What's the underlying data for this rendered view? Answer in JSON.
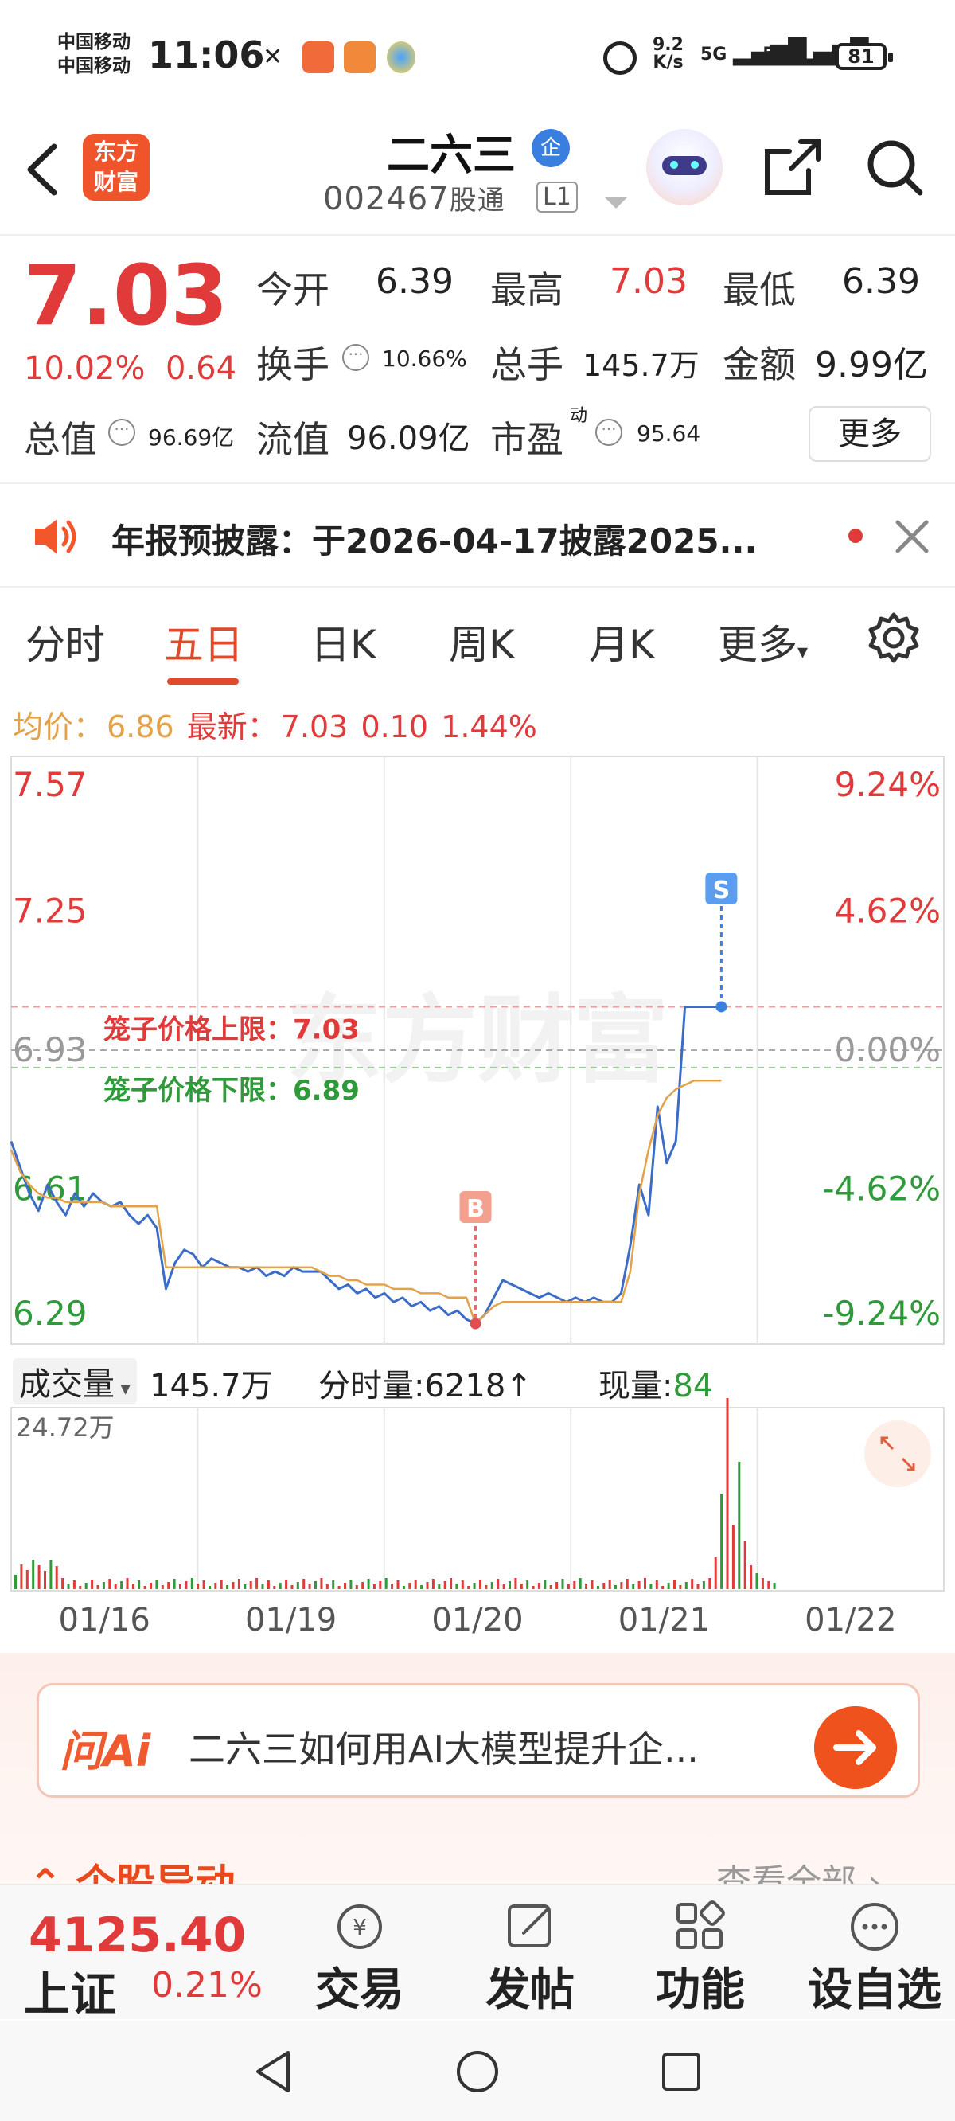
{
  "status_bar": {
    "carrier_1": "中国移动",
    "carrier_2": "中国移动",
    "time": "11:06",
    "net_speed_value": "9.2",
    "net_speed_unit": "K/s",
    "signal_1": "5G",
    "signal_2": "5G",
    "battery": "81"
  },
  "header": {
    "logo_line1": "东方",
    "logo_line2": "财富",
    "stock_name": "二六三",
    "badge": "企",
    "stock_code": "002467",
    "connect_label": "股通",
    "level": "L1"
  },
  "quote": {
    "price": "7.03",
    "change_pct": "10.02%",
    "change_abs": "0.64",
    "open_label": "今开",
    "open": "6.39",
    "high_label": "最高",
    "high": "7.03",
    "low_label": "最低",
    "low": "6.39",
    "turnover_label": "换手",
    "turnover": "10.66%",
    "volume_label": "总手",
    "volume": "145.7万",
    "amount_label": "金额",
    "amount": "9.99亿",
    "mktcap_label": "总值",
    "mktcap": "96.69亿",
    "float_label": "流值",
    "float_cap": "96.09亿",
    "pe_label": "市盈",
    "pe_sup": "动",
    "pe": "95.64",
    "more_label": "更多"
  },
  "notice": {
    "text": "年报预披露：于2026-04-17披露2025..."
  },
  "tabs": [
    {
      "label": "分时"
    },
    {
      "label": "五日"
    },
    {
      "label": "日K"
    },
    {
      "label": "周K"
    },
    {
      "label": "月K"
    },
    {
      "label": "更多"
    }
  ],
  "avg": {
    "avg_label": "均价：",
    "avg_value": "6.86",
    "latest_label": "最新：",
    "latest_value": "7.03",
    "latest_change": "0.10",
    "latest_pct": "1.44%"
  },
  "chart_data": {
    "type": "line",
    "y_labels_left": [
      "7.57",
      "7.25",
      "6.93",
      "6.61",
      "6.29"
    ],
    "y_labels_right": [
      "9.24%",
      "4.62%",
      "0.00%",
      "-4.62%",
      "-9.24%"
    ],
    "ylim": [
      6.29,
      7.57
    ],
    "x_labels": [
      "01/16",
      "01/19",
      "01/20",
      "01/21",
      "01/22"
    ],
    "cage_upper_label": "笼子价格上限：7.03",
    "cage_lower_label": "笼子价格下限：6.89",
    "cage_upper": 7.03,
    "cage_lower": 6.89,
    "buy_marker": "B",
    "sell_marker": "S",
    "watermark": "东方财富",
    "series": [
      {
        "name": "price",
        "color": "#3b6cc7",
        "values": [
          6.72,
          6.66,
          6.6,
          6.56,
          6.62,
          6.58,
          6.55,
          6.6,
          6.57,
          6.6,
          6.58,
          6.57,
          6.58,
          6.55,
          6.53,
          6.55,
          6.52,
          6.38,
          6.44,
          6.47,
          6.46,
          6.43,
          6.45,
          6.44,
          6.43,
          6.43,
          6.42,
          6.43,
          6.41,
          6.42,
          6.41,
          6.43,
          6.42,
          6.42,
          6.42,
          6.4,
          6.38,
          6.39,
          6.37,
          6.38,
          6.36,
          6.37,
          6.35,
          6.36,
          6.34,
          6.35,
          6.33,
          6.34,
          6.32,
          6.33,
          6.31,
          6.3,
          6.32,
          6.36,
          6.4,
          6.39,
          6.38,
          6.37,
          6.36,
          6.37,
          6.36,
          6.35,
          6.36,
          6.35,
          6.36,
          6.35,
          6.35,
          6.37,
          6.48,
          6.62,
          6.55,
          6.8,
          6.67,
          6.72,
          7.03,
          7.03,
          7.03,
          7.03,
          7.03
        ]
      },
      {
        "name": "avg",
        "color": "#e3a24a",
        "values": [
          6.7,
          6.65,
          6.62,
          6.6,
          6.59,
          6.59,
          6.58,
          6.58,
          6.58,
          6.58,
          6.58,
          6.57,
          6.57,
          6.57,
          6.57,
          6.57,
          6.57,
          6.43,
          6.43,
          6.43,
          6.43,
          6.43,
          6.43,
          6.43,
          6.43,
          6.43,
          6.43,
          6.43,
          6.43,
          6.43,
          6.43,
          6.43,
          6.43,
          6.43,
          6.42,
          6.41,
          6.41,
          6.4,
          6.4,
          6.39,
          6.39,
          6.39,
          6.38,
          6.38,
          6.38,
          6.37,
          6.37,
          6.37,
          6.36,
          6.36,
          6.36,
          6.3,
          6.32,
          6.34,
          6.35,
          6.35,
          6.35,
          6.35,
          6.35,
          6.35,
          6.35,
          6.35,
          6.35,
          6.35,
          6.35,
          6.35,
          6.35,
          6.35,
          6.42,
          6.6,
          6.7,
          6.78,
          6.82,
          6.84,
          6.85,
          6.86,
          6.86,
          6.86,
          6.86
        ]
      }
    ],
    "volume_max_label": "24.72万"
  },
  "volume": {
    "label": "成交量",
    "total": "145.7万",
    "tick_label": "分时量:",
    "tick_value": "6218",
    "now_label": "现量:",
    "now_value": "84"
  },
  "ai": {
    "logo": "问Ai",
    "text": "二六三如何用AI大模型提升企...",
    "section_title": "个股异动",
    "view_all": "查看全部"
  },
  "bottom_nav": {
    "index_value": "4125.40",
    "index_name": "上证",
    "index_pct": "0.21%",
    "items": [
      {
        "label": "交易"
      },
      {
        "label": "发帖"
      },
      {
        "label": "功能"
      },
      {
        "label": "设自选"
      }
    ]
  }
}
